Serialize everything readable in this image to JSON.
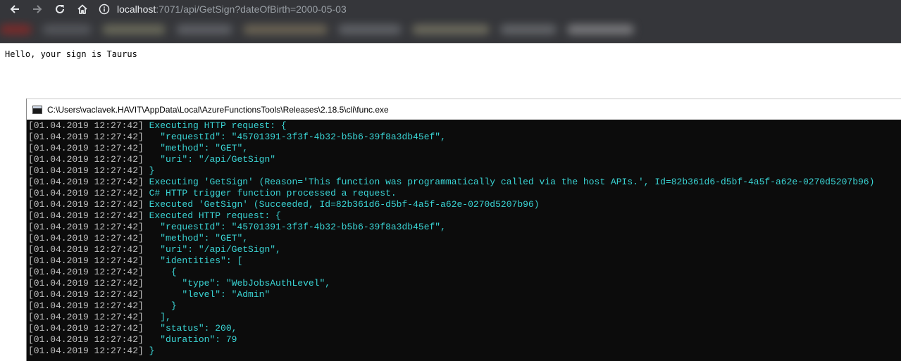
{
  "browser": {
    "url_host": "localhost",
    "url_rest": ":7071/api/GetSign?dateOfBirth=2000-05-03"
  },
  "page": {
    "body_text": "Hello, your sign is Taurus"
  },
  "console": {
    "title": "C:\\Users\\vaclavek.HAVIT\\AppData\\Local\\AzureFunctionsTools\\Releases\\2.18.5\\cli\\func.exe",
    "lines": [
      {
        "ts": "[01.04.2019 12:27:42]",
        "msg": " Executing HTTP request: {"
      },
      {
        "ts": "[01.04.2019 12:27:42]",
        "msg": "   \"requestId\": \"45701391-3f3f-4b32-b5b6-39f8a3db45ef\","
      },
      {
        "ts": "[01.04.2019 12:27:42]",
        "msg": "   \"method\": \"GET\","
      },
      {
        "ts": "[01.04.2019 12:27:42]",
        "msg": "   \"uri\": \"/api/GetSign\""
      },
      {
        "ts": "[01.04.2019 12:27:42]",
        "msg": " }"
      },
      {
        "ts": "[01.04.2019 12:27:42]",
        "msg": " Executing 'GetSign' (Reason='This function was programmatically called via the host APIs.', Id=82b361d6-d5bf-4a5f-a62e-0270d5207b96)"
      },
      {
        "ts": "[01.04.2019 12:27:42]",
        "msg": " C# HTTP trigger function processed a request."
      },
      {
        "ts": "[01.04.2019 12:27:42]",
        "msg": " Executed 'GetSign' (Succeeded, Id=82b361d6-d5bf-4a5f-a62e-0270d5207b96)"
      },
      {
        "ts": "[01.04.2019 12:27:42]",
        "msg": " Executed HTTP request: {"
      },
      {
        "ts": "[01.04.2019 12:27:42]",
        "msg": "   \"requestId\": \"45701391-3f3f-4b32-b5b6-39f8a3db45ef\","
      },
      {
        "ts": "[01.04.2019 12:27:42]",
        "msg": "   \"method\": \"GET\","
      },
      {
        "ts": "[01.04.2019 12:27:42]",
        "msg": "   \"uri\": \"/api/GetSign\","
      },
      {
        "ts": "[01.04.2019 12:27:42]",
        "msg": "   \"identities\": ["
      },
      {
        "ts": "[01.04.2019 12:27:42]",
        "msg": "     {"
      },
      {
        "ts": "[01.04.2019 12:27:42]",
        "msg": "       \"type\": \"WebJobsAuthLevel\","
      },
      {
        "ts": "[01.04.2019 12:27:42]",
        "msg": "       \"level\": \"Admin\""
      },
      {
        "ts": "[01.04.2019 12:27:42]",
        "msg": "     }"
      },
      {
        "ts": "[01.04.2019 12:27:42]",
        "msg": "   ],"
      },
      {
        "ts": "[01.04.2019 12:27:42]",
        "msg": "   \"status\": 200,"
      },
      {
        "ts": "[01.04.2019 12:27:42]",
        "msg": "   \"duration\": 79"
      },
      {
        "ts": "[01.04.2019 12:27:42]",
        "msg": " }"
      }
    ]
  },
  "icons": {
    "back": "back-arrow-icon",
    "forward": "forward-arrow-icon",
    "reload": "reload-icon",
    "home": "home-icon",
    "info": "info-icon"
  },
  "colors": {
    "toolbar_bg": "#35363a",
    "console_bg": "#0c0c0c",
    "timestamp": "#c0c0c0",
    "message": "#3ad4d4"
  }
}
